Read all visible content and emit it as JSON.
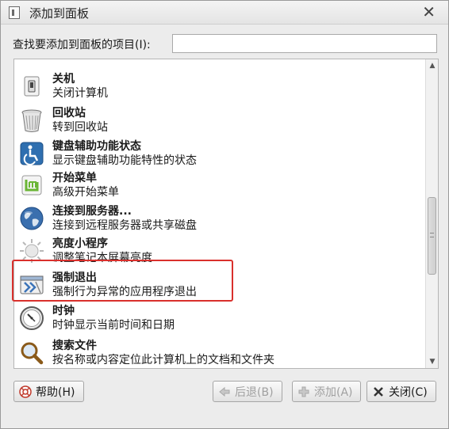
{
  "window": {
    "title": "添加到面板"
  },
  "search": {
    "label": "查找要添加到面板的项目(I):",
    "value": "",
    "placeholder": ""
  },
  "items": [
    {
      "name": "关机",
      "desc": "关闭计算机",
      "icon": "shutdown-icon"
    },
    {
      "name": "回收站",
      "desc": "转到回收站",
      "icon": "trash-icon"
    },
    {
      "name": "键盘辅助功能状态",
      "desc": "显示键盘辅助功能特性的状态",
      "icon": "accessibility-icon"
    },
    {
      "name": "开始菜单",
      "desc": "高级开始菜单",
      "icon": "mint-menu-icon"
    },
    {
      "name": "连接到服务器...",
      "desc": "连接到远程服务器或共享磁盘",
      "icon": "network-globe-icon"
    },
    {
      "name": "亮度小程序",
      "desc": "调整笔记本屏幕亮度",
      "icon": "brightness-icon"
    },
    {
      "name": "强制退出",
      "desc": "强制行为异常的应用程序退出",
      "icon": "force-quit-icon"
    },
    {
      "name": "时钟",
      "desc": "时钟显示当前时间和日期",
      "icon": "clock-icon"
    },
    {
      "name": "搜索文件",
      "desc": "按名称或内容定位此计算机上的文档和文件夹",
      "icon": "search-icon"
    }
  ],
  "buttons": {
    "help": "帮助(H)",
    "back": "后退(B)",
    "add": "添加(A)",
    "close": "关闭(C)"
  },
  "colors": {
    "highlight": "#d9302c"
  }
}
